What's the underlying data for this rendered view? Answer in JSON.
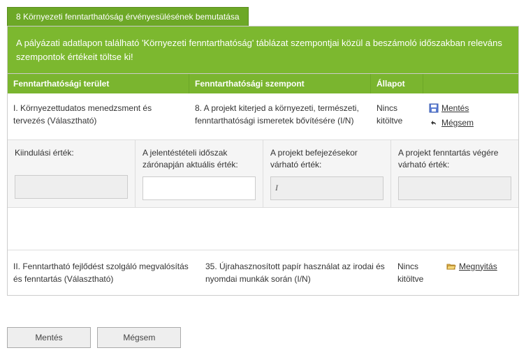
{
  "tab": {
    "title": "8 Környezeti fenntarthatóság érvényesülésének bemutatása"
  },
  "banner": {
    "text": "A pályázati adatlapon található 'Környezeti fenntarthatóság' táblázat szempontjai közül a beszámoló időszakban releváns szempontok értékeit töltse ki!"
  },
  "headers": {
    "area": "Fenntarthatósági terület",
    "aspect": "Fenntarthatósági szempont",
    "status": "Állapot",
    "actions": ""
  },
  "row1": {
    "area": "I. Környezettudatos menedzsment és tervezés (Választható)",
    "aspect": "8. A projekt kiterjed a környezeti, természeti, fenntarthatósági ismeretek bővítésére (I/N)",
    "status": "Nincs kitöltve",
    "save": "Mentés",
    "cancel": "Mégsem"
  },
  "fields": {
    "f1": {
      "label": "Kiindulási érték:",
      "value": ""
    },
    "f2": {
      "label": "A jelentéstételi időszak zárónapján aktuális érték:",
      "value": ""
    },
    "f3": {
      "label": "A projekt befejezésekor várható érték:",
      "value": "I"
    },
    "f4": {
      "label": "A projekt fenntartás végére várható érték:",
      "value": ""
    }
  },
  "row2": {
    "area": "II. Fenntartható fejlődést szolgáló megvalósítás és fenntartás (Választható)",
    "aspect": "35. Újrahasznosított papír használat az irodai és nyomdai munkák során (I/N)",
    "status": "Nincs kitöltve",
    "open": "Megnyitás"
  },
  "buttons": {
    "save": "Mentés",
    "cancel": "Mégsem"
  }
}
